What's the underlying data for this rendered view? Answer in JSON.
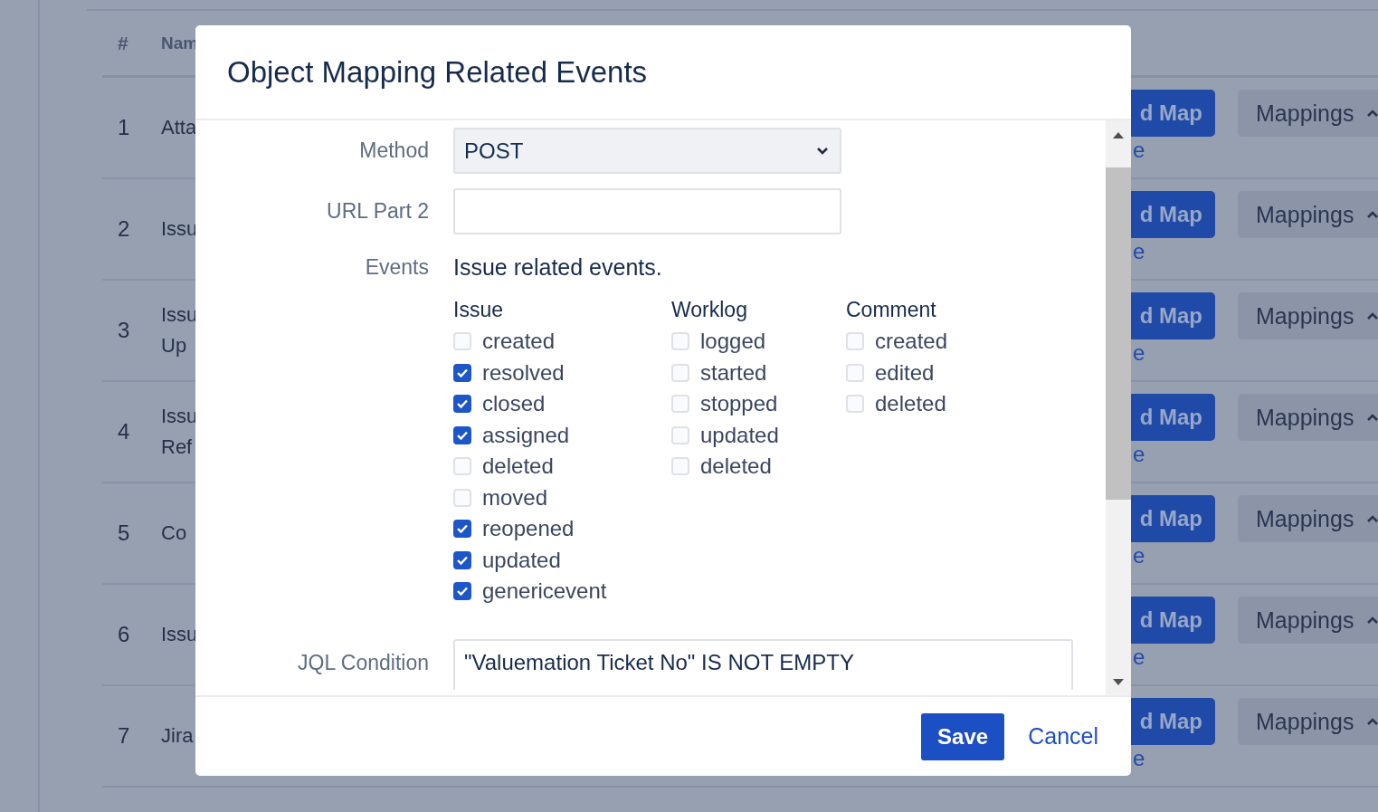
{
  "background_table": {
    "columns": [
      {
        "label": "#"
      },
      {
        "label": "Nam"
      }
    ],
    "rows": [
      {
        "number": "1",
        "name": [
          "Atta"
        ],
        "add_button": "d Map",
        "link": "e",
        "mappings_button": "Mappings"
      },
      {
        "number": "2",
        "name": [
          "Issu"
        ],
        "add_button": "d Map",
        "link": "e",
        "mappings_button": "Mappings"
      },
      {
        "number": "3",
        "name": [
          "Issu",
          "Up"
        ],
        "add_button": "d Map",
        "link": "e",
        "mappings_button": "Mappings"
      },
      {
        "number": "4",
        "name": [
          "Issu",
          "Ref"
        ],
        "add_button": "d Map",
        "link": "e",
        "mappings_button": "Mappings"
      },
      {
        "number": "5",
        "name": [
          "Co"
        ],
        "add_button": "d Map",
        "link": "e",
        "mappings_button": "Mappings"
      },
      {
        "number": "6",
        "name": [
          "Issu"
        ],
        "add_button": "d Map",
        "link": "e",
        "mappings_button": "Mappings"
      },
      {
        "number": "7",
        "name": [
          "Jira"
        ],
        "add_button": "d Map",
        "link": "e",
        "mappings_button": "Mappings"
      }
    ]
  },
  "dialog": {
    "title": "Object Mapping Related Events",
    "method": {
      "label": "Method",
      "value": "POST"
    },
    "url_part": {
      "label": "URL Part 2"
    },
    "events": {
      "label": "Events",
      "heading": "Issue related events.",
      "groups": [
        {
          "title": "Issue",
          "items": [
            {
              "label": "created",
              "checked": false
            },
            {
              "label": "resolved",
              "checked": true
            },
            {
              "label": "closed",
              "checked": true
            },
            {
              "label": "assigned",
              "checked": true
            },
            {
              "label": "deleted",
              "checked": false
            },
            {
              "label": "moved",
              "checked": false
            },
            {
              "label": "reopened",
              "checked": true
            },
            {
              "label": "updated",
              "checked": true
            },
            {
              "label": "genericevent",
              "checked": true
            }
          ]
        },
        {
          "title": "Worklog",
          "items": [
            {
              "label": "logged",
              "checked": false
            },
            {
              "label": "started",
              "checked": false
            },
            {
              "label": "stopped",
              "checked": false
            },
            {
              "label": "updated",
              "checked": false
            },
            {
              "label": "deleted",
              "checked": false
            }
          ]
        },
        {
          "title": "Comment",
          "items": [
            {
              "label": "created",
              "checked": false
            },
            {
              "label": "edited",
              "checked": false
            },
            {
              "label": "deleted",
              "checked": false
            }
          ]
        }
      ]
    },
    "jql": {
      "label": "JQL Condition",
      "value": "\"Valuemation Ticket No\" IS NOT EMPTY"
    },
    "save_button": "Save",
    "cancel_link": "Cancel"
  }
}
